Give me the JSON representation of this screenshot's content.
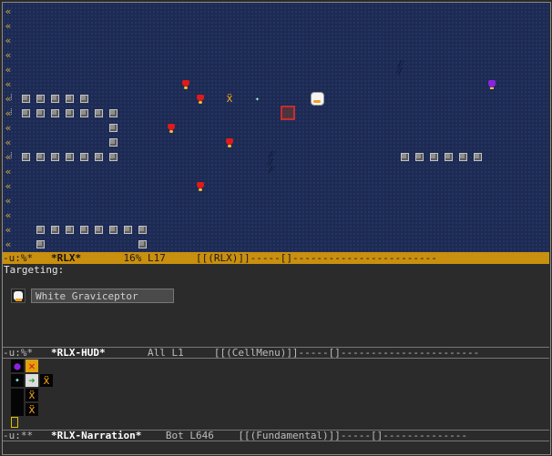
{
  "windows": {
    "map": {
      "modeline": {
        "flags": "-u:%*",
        "buffer": "*RLX*",
        "position": "16%",
        "line": "L17",
        "mode": "[[(RLX)]]-----[]------------------------"
      }
    },
    "targeting": {
      "label": "Targeting:",
      "target_name": "White Graviceptor",
      "target_icon": "white-graviceptor-icon"
    },
    "hud": {
      "modeline": {
        "flags": "-u:%*",
        "buffer": "*RLX-HUD*",
        "position": "All",
        "line": "L1",
        "mode": "[[(CellMenu)]]-----[]-----------------------"
      },
      "cells": [
        {
          "icon": "purple-fly-icon"
        },
        {
          "icon": "red-x-icon"
        },
        {
          "icon": "spark-icon"
        },
        {
          "icon": "green-arrow-icon"
        },
        {
          "icon": "orange-crab-icon"
        },
        {
          "icon": "orange-crab-icon"
        },
        {
          "icon": "orange-crab-icon"
        }
      ]
    },
    "narration": {
      "modeline": {
        "flags": "-u:**",
        "buffer": "*RLX-Narration*",
        "position": "Bot",
        "line": "L646",
        "mode": "[[(Fundamental)]]-----[]--------------"
      }
    }
  },
  "colors": {
    "map_background": "#1d2a52",
    "active_modeline": "#c98f0f",
    "panel_background": "#2b2b2b",
    "edge_arrow": "#c9a43a"
  },
  "entities": [
    {
      "name": "red-fly-icon"
    },
    {
      "name": "orange-crab-icon"
    },
    {
      "name": "white-graviceptor-icon"
    },
    {
      "name": "purple-fly-icon"
    },
    {
      "name": "target-cursor-icon"
    },
    {
      "name": "spark-icon"
    }
  ]
}
